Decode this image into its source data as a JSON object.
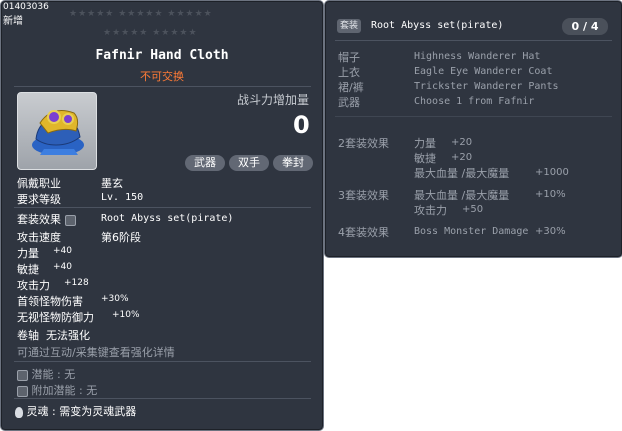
{
  "item": {
    "id": "01403036",
    "tag": "新增",
    "stars_top": "★★★★★  ★★★★★  ★★★★★",
    "stars_bottom": "★★★★★  ★★★★★",
    "name": "Fafnir Hand Cloth",
    "trade_note": "不可交换",
    "power_label": "战斗力增加量",
    "power_value": "0",
    "tags": [
      "武器",
      "双手",
      "拳封"
    ],
    "job_label": "佩戴职业",
    "job_value": "墨玄",
    "level_label": "要求等级",
    "level_value": "Lv. 150",
    "set_label": "套装效果",
    "set_value": "Root Abyss set(pirate)",
    "speed_label": "攻击速度",
    "speed_value": "第6阶段",
    "stats": [
      {
        "label": "力量",
        "value": "+40"
      },
      {
        "label": "敏捷",
        "value": "+40"
      },
      {
        "label": "攻击力",
        "value": "+128"
      },
      {
        "label": "首领怪物伤害",
        "value": "+30%"
      },
      {
        "label": "无视怪物防御力",
        "value": "+10%"
      }
    ],
    "scroll_label": "卷轴",
    "scroll_value": "无法强化",
    "enhance_hint": "可通过互动/采集键查看强化详情",
    "potential_label": "潜能",
    "potential_value": "无",
    "add_potential_label": "附加潜能",
    "add_potential_value": "无",
    "soul_label": "灵魂",
    "soul_value": "需变为灵魂武器",
    "colors": {
      "panel": "#2f3540",
      "trade_note": "#ff7b36",
      "muted": "#9aa0aa"
    },
    "icon": "fist-weapon-icon"
  },
  "set": {
    "badge": "套装",
    "title": "Root Abyss set(pirate)",
    "count": "0 / 4",
    "pieces": [
      {
        "slot": "帽子",
        "name": "Highness Wanderer Hat"
      },
      {
        "slot": "上衣",
        "name": "Eagle Eye Wanderer Coat"
      },
      {
        "slot": "裙/裤",
        "name": "Trickster Wanderer Pants"
      },
      {
        "slot": "武器",
        "name": "Choose 1 from Fafnir"
      }
    ],
    "effects": [
      {
        "tier": "2套装效果",
        "lines": [
          {
            "label": "力量",
            "value": "+20"
          },
          {
            "label": "敏捷",
            "value": "+20"
          },
          {
            "label": "最大血量 /最大魔量",
            "value": "+1000"
          }
        ]
      },
      {
        "tier": "3套装效果",
        "lines": [
          {
            "label": "最大血量 /最大魔量",
            "value": "+10%"
          },
          {
            "label": "攻击力",
            "value": "+50"
          }
        ]
      },
      {
        "tier": "4套装效果",
        "lines": [
          {
            "label": "Boss Monster Damage",
            "value": "+30%"
          }
        ]
      }
    ]
  }
}
